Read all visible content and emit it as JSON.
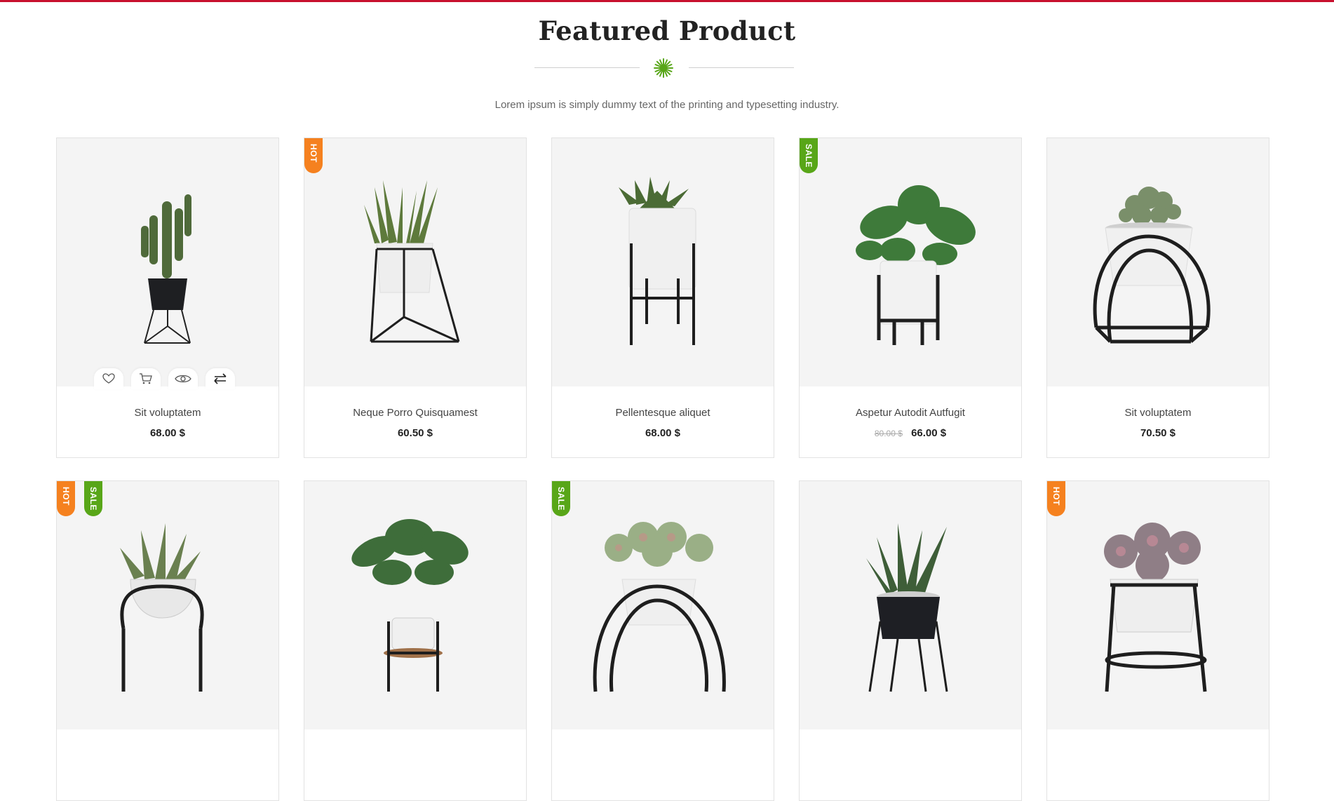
{
  "section": {
    "title": "Featured Product",
    "subtitle": "Lorem ipsum is simply dummy text of the printing and typesetting industry."
  },
  "colors": {
    "accent_green": "#58a618",
    "hot_orange": "#f5811f",
    "top_border": "#c8102e"
  },
  "actions": {
    "icons": [
      "heart-icon",
      "cart-icon",
      "eye-icon",
      "compare-icon"
    ]
  },
  "products": [
    {
      "name": "Sit voluptatem",
      "price": "68.00 $",
      "old_price": "",
      "badges": []
    },
    {
      "name": "Neque Porro Quisquamest",
      "price": "60.50 $",
      "old_price": "",
      "badges": [
        "HOT"
      ]
    },
    {
      "name": "Pellentesque aliquet",
      "price": "68.00 $",
      "old_price": "",
      "badges": []
    },
    {
      "name": "Aspetur Autodit Autfugit",
      "price": "66.00 $",
      "old_price": "80.00 $",
      "badges": [
        "SALE"
      ]
    },
    {
      "name": "Sit voluptatem",
      "price": "70.50 $",
      "old_price": "",
      "badges": []
    },
    {
      "name": "",
      "price": "",
      "old_price": "",
      "badges": [
        "HOT",
        "SALE"
      ]
    },
    {
      "name": "",
      "price": "",
      "old_price": "",
      "badges": []
    },
    {
      "name": "",
      "price": "",
      "old_price": "",
      "badges": [
        "SALE"
      ]
    },
    {
      "name": "",
      "price": "",
      "old_price": "",
      "badges": []
    },
    {
      "name": "",
      "price": "",
      "old_price": "",
      "badges": [
        "HOT"
      ]
    }
  ]
}
